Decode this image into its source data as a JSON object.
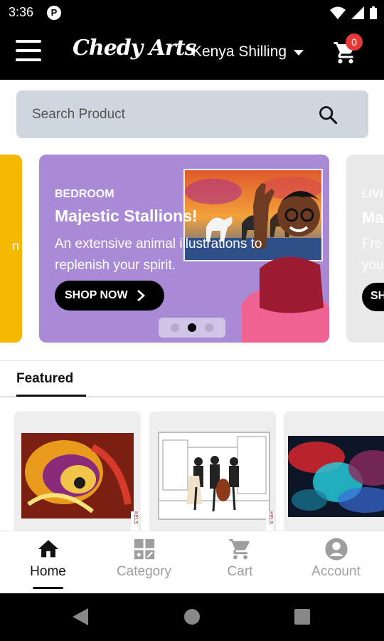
{
  "status_bar": {
    "time": "3:36",
    "badge": "P"
  },
  "app_bar": {
    "logo": "Chedy Arts",
    "currency": "Kenya Shilling",
    "cart_count": "0"
  },
  "search": {
    "placeholder": "Search Product"
  },
  "banners": {
    "left_peek": {
      "text": "n"
    },
    "main": {
      "category": "BEDROOM",
      "title": "Majestic Stallions!",
      "subtitle": "An extensive animal illustrations to replenish your spirit.",
      "button": "SHOP NOW"
    },
    "right_peek": {
      "category": "LIVI",
      "title": "Ma",
      "sub1": "Fre",
      "sub2": "you",
      "button": "SH"
    },
    "carousel": {
      "count": 3,
      "active_index": 1
    }
  },
  "featured": {
    "tab_label": "Featured"
  },
  "products": [
    {
      "name": "abstract-woman-painting",
      "tag": "KELS"
    },
    {
      "name": "street-musicians-sketch",
      "tag": "KELS"
    },
    {
      "name": "colorful-cloud-painting",
      "tag": ""
    }
  ],
  "bottom_nav": {
    "items": [
      {
        "label": "Home",
        "icon": "home-icon",
        "active": true
      },
      {
        "label": "Category",
        "icon": "category-icon",
        "active": false
      },
      {
        "label": "Cart",
        "icon": "cart-icon",
        "active": false
      },
      {
        "label": "Account",
        "icon": "account-icon",
        "active": false
      }
    ]
  },
  "colors": {
    "app_bar": "#000000",
    "banner_main": "#a98ad6",
    "banner_left": "#f5b800",
    "search_bg": "#cfd6de",
    "badge": "#e53935"
  }
}
